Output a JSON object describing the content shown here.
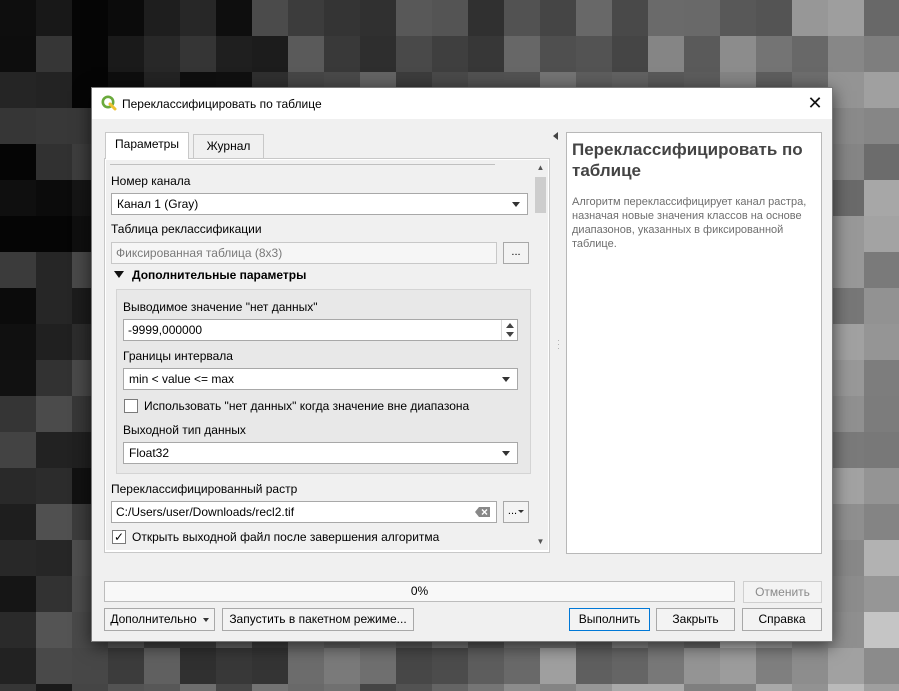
{
  "dialog": {
    "title": "Переклассифицировать по таблице",
    "close_glyph": "✕"
  },
  "tabs": [
    {
      "label": "Параметры",
      "active": true
    },
    {
      "label": "Журнал",
      "active": false
    }
  ],
  "params": {
    "band_label": "Номер канала",
    "band_value": "Канал 1 (Gray)",
    "table_label": "Таблица реклассификации",
    "table_value": "Фиксированная таблица (8x3)",
    "table_button": "...",
    "advanced_header": "Дополнительные параметры",
    "nodata_label": "Выводимое значение \"нет данных\"",
    "nodata_value": "-9999,000000",
    "range_label": "Границы интервала",
    "range_value": "min < value <= max",
    "nodata_for_missing_label": "Использовать \"нет данных\" когда значение вне диапазона",
    "nodata_for_missing_checked": false,
    "datatype_label": "Выходной тип данных",
    "datatype_value": "Float32",
    "output_label": "Переклассифицированный растр",
    "output_value": "C:/Users/user/Downloads/recl2.tif",
    "output_button": "...",
    "open_after_label": "Открыть выходной файл после завершения алгоритма",
    "open_after_checked": true,
    "check_glyph": "✓"
  },
  "help": {
    "title": "Переклассифицировать по таблице",
    "text": "Алгоритм переклассифицирует канал растра, назначая новые значения классов на основе диапазонов, указанных в фиксированной таблице."
  },
  "progress": {
    "percent_text": "0%",
    "value": 0
  },
  "buttons": {
    "cancel": "Отменить",
    "advanced": "Дополнительно",
    "batch": "Запустить в пакетном режиме...",
    "run": "Выполнить",
    "close": "Закрыть",
    "help": "Справка"
  },
  "colors": {
    "accent": "#0078d7",
    "qgis_green": "#6aaa3c",
    "qgis_yellow": "#efc32f"
  }
}
